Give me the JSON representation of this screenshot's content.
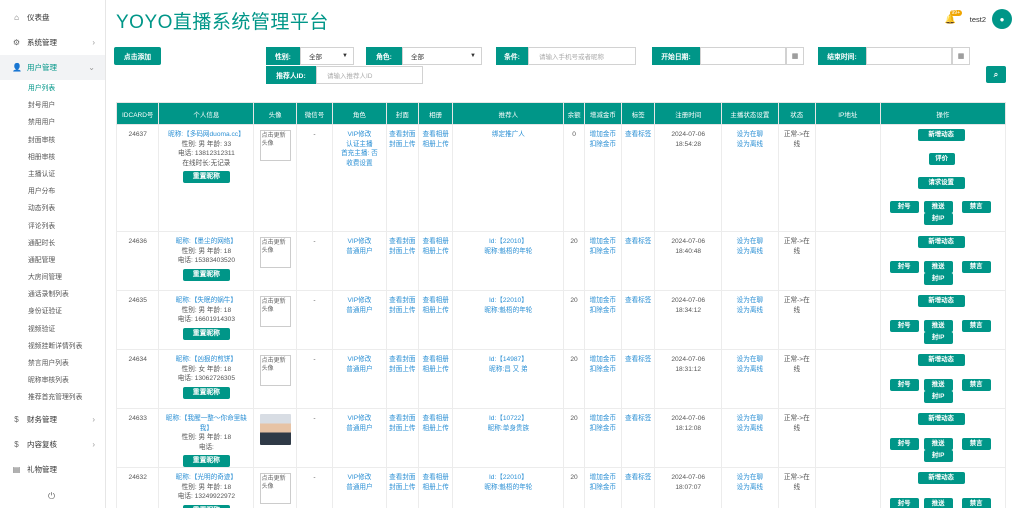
{
  "sidebar": {
    "top_items": [
      {
        "label": "仪表盘",
        "icon": "home-icon",
        "glyph": "⌂"
      },
      {
        "label": "系统管理",
        "icon": "cog-icon",
        "glyph": "⚙"
      },
      {
        "label": "用户管理",
        "icon": "user-icon",
        "glyph": "👤"
      }
    ],
    "sub_items": [
      "用户列表",
      "封号用户",
      "禁用用户",
      "封面审核",
      "相册审核",
      "主播认证",
      "用户分布",
      "动态列表",
      "评论列表",
      "通配时长",
      "通配管理",
      "大房间管理",
      "通话录制列表",
      "身份证验证",
      "视频验证",
      "视频挂断详情列表",
      "禁言用户列表",
      "昵称审核列表",
      "推荐首充管理列表"
    ],
    "bottom_items": [
      {
        "label": "财务管理",
        "icon": "dollar-icon",
        "glyph": "$"
      },
      {
        "label": "内容复核",
        "icon": "dollar-icon",
        "glyph": "$"
      },
      {
        "label": "礼物管理",
        "icon": "gift-icon",
        "glyph": "▤"
      }
    ],
    "power_glyph": "⏻"
  },
  "header": {
    "title": "YOYO直播系统管理平台",
    "username": "test2",
    "bell_badge": "99+"
  },
  "toolbar": {
    "add_label": "点击添加"
  },
  "filters": {
    "gender_label": "性别:",
    "gender_value": "全部",
    "role_label": "角色:",
    "role_value": "全部",
    "condition_label": "条件:",
    "condition_placeholder": "请输入手机号或者昵称",
    "start_label": "开始日期:",
    "end_label": "结束时间:",
    "referrer_label": "推荐人ID:",
    "referrer_placeholder": "请输入推荐人ID",
    "search_glyph": "⌕",
    "calendar_glyph": "▦"
  },
  "table": {
    "headers": [
      "IDCARD号",
      "个人信息",
      "头像",
      "微信号",
      "角色",
      "封面",
      "相册",
      "推荐人",
      "余额",
      "增减金币",
      "标签",
      "注册时间",
      "主播状态设置",
      "状态",
      "IP地址",
      "操作"
    ],
    "rows": [
      {
        "id": "24637",
        "nick": "昵称:【多码网duoma.cc】",
        "gender_age": "性别: 男 年龄: 33",
        "phone": "电话: 13812312311",
        "extra": "在线时长:无记录",
        "avatar": "点击更新头像",
        "photo": false,
        "wechat": "-",
        "role_link": "VIP修改",
        "role_lines": [
          "认证主播",
          "首充主播: 否",
          "收费设置"
        ],
        "cover": "查看封面",
        "cover_up": "封面上传",
        "album": "查看相册",
        "album_up": "相册上传",
        "ref": "绑定推广人",
        "ref_nick": "",
        "balance": "0",
        "coins_add": "增加金币",
        "coins_sub": "扣除金币",
        "tag": "查看标签",
        "date": "2024-07-06",
        "time": "18:54:28",
        "host1": "设为在聊",
        "host2": "设为离线",
        "status": "正常->在线",
        "ops_top": [
          "新增动态",
          "评价",
          "请求设置"
        ]
      },
      {
        "id": "24636",
        "nick": "昵称:【墨尘的网络】",
        "gender_age": "性别: 男 年龄: 18",
        "phone": "电话: 15383403520",
        "extra": "",
        "avatar": "点击更新头像",
        "photo": false,
        "wechat": "-",
        "role_link": "VIP修改",
        "role_lines": [
          "普通用户"
        ],
        "cover": "查看封面",
        "cover_up": "封面上传",
        "album": "查看相册",
        "album_up": "相册上传",
        "ref": "Id:【22010】",
        "ref_nick": "昵称:魁梧的年轮",
        "balance": "20",
        "coins_add": "增加金币",
        "coins_sub": "扣除金币",
        "tag": "查看标签",
        "date": "2024-07-06",
        "time": "18:40:48",
        "host1": "设为在聊",
        "host2": "设为离线",
        "status": "正常->在线",
        "ops_top": [
          "新增动态"
        ]
      },
      {
        "id": "24635",
        "nick": "昵称:【失眠的蜗牛】",
        "gender_age": "性别: 男 年龄: 18",
        "phone": "电话: 16601914303",
        "extra": "",
        "avatar": "点击更新头像",
        "photo": false,
        "wechat": "-",
        "role_link": "VIP修改",
        "role_lines": [
          "普通用户"
        ],
        "cover": "查看封面",
        "cover_up": "封面上传",
        "album": "查看相册",
        "album_up": "相册上传",
        "ref": "Id:【22010】",
        "ref_nick": "昵称:魁梧的年轮",
        "balance": "20",
        "coins_add": "增加金币",
        "coins_sub": "扣除金币",
        "tag": "查看标签",
        "date": "2024-07-06",
        "time": "18:34:12",
        "host1": "设为在聊",
        "host2": "设为离线",
        "status": "正常->在线",
        "ops_top": [
          "新增动态"
        ]
      },
      {
        "id": "24634",
        "nick": "昵称:【凶狠的煎饼】",
        "gender_age": "性别: 女 年龄: 18",
        "phone": "电话: 13062726305",
        "extra": "",
        "avatar": "点击更新头像",
        "photo": false,
        "wechat": "-",
        "role_link": "VIP修改",
        "role_lines": [
          "普通用户"
        ],
        "cover": "查看封面",
        "cover_up": "封面上传",
        "album": "查看相册",
        "album_up": "相册上传",
        "ref": "Id:【14987】",
        "ref_nick": "昵称:昌 又 弟",
        "balance": "20",
        "coins_add": "增加金币",
        "coins_sub": "扣除金币",
        "tag": "查看标签",
        "date": "2024-07-06",
        "time": "18:31:12",
        "host1": "设为在聊",
        "host2": "设为离线",
        "status": "正常->在线",
        "ops_top": [
          "新增动态"
        ]
      },
      {
        "id": "24633",
        "nick": "昵称:【我醒一整～你命里缺我】",
        "gender_age": "性别: 男 年龄: 18",
        "phone": "电话:",
        "extra": "",
        "avatar": "",
        "photo": true,
        "wechat": "-",
        "role_link": "VIP修改",
        "role_lines": [
          "普通用户"
        ],
        "cover": "查看封面",
        "cover_up": "封面上传",
        "album": "查看相册",
        "album_up": "相册上传",
        "ref": "Id:【10722】",
        "ref_nick": "昵称:单身贵族",
        "balance": "20",
        "coins_add": "增加金币",
        "coins_sub": "扣除金币",
        "tag": "查看标签",
        "date": "2024-07-06",
        "time": "18:12:08",
        "host1": "设为在聊",
        "host2": "设为离线",
        "status": "正常->在线",
        "ops_top": [
          "新增动态"
        ]
      },
      {
        "id": "24632",
        "nick": "昵称:【光明的奇迹】",
        "gender_age": "性别: 男 年龄: 18",
        "phone": "电话: 13249922972",
        "extra": "",
        "avatar": "点击更新头像",
        "photo": false,
        "wechat": "-",
        "role_link": "VIP修改",
        "role_lines": [
          "普通用户"
        ],
        "cover": "查看封面",
        "cover_up": "封面上传",
        "album": "查看相册",
        "album_up": "相册上传",
        "ref": "Id:【22010】",
        "ref_nick": "昵称:魁梧的年轮",
        "balance": "20",
        "coins_add": "增加金币",
        "coins_sub": "扣除金币",
        "tag": "查看标签",
        "date": "2024-07-06",
        "time": "18:07:07",
        "host1": "设为在聊",
        "host2": "设为离线",
        "status": "正常->在线",
        "ops_top": [
          "新增动态"
        ]
      }
    ],
    "reset_nick": "重置昵称",
    "op_ban": "封号",
    "op_push": "推送",
    "op_mute": "禁言",
    "op_ipban": "封IP"
  }
}
